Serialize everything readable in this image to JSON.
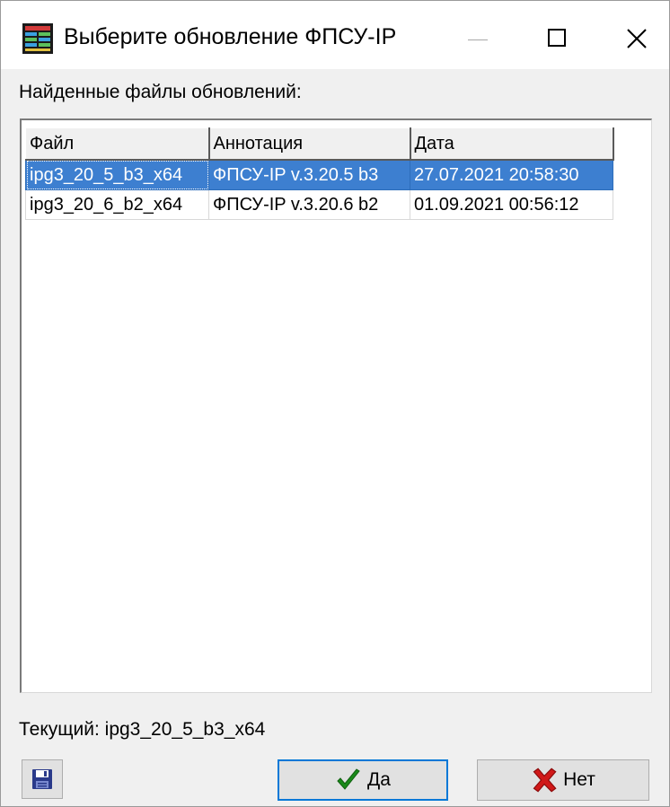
{
  "window": {
    "title": "Выберите обновление ФПСУ-IP",
    "icon": "grid-app-icon",
    "controls": {
      "minimize": "minimize-icon",
      "maximize": "maximize-icon",
      "close": "close-icon"
    }
  },
  "found_label": "Найденные файлы обновлений:",
  "table": {
    "columns": [
      "Файл",
      "Аннотация",
      "Дата"
    ],
    "rows": [
      {
        "file": "ipg3_20_5_b3_x64",
        "annotation": "ФПСУ-IP v.3.20.5 b3",
        "date": "27.07.2021 20:58:30",
        "selected": true
      },
      {
        "file": "ipg3_20_6_b2_x64",
        "annotation": "ФПСУ-IP v.3.20.6 b2",
        "date": "01.09.2021 00:56:12",
        "selected": false
      }
    ]
  },
  "current": "Текущий: ipg3_20_5_b3_x64",
  "buttons": {
    "save_icon": "floppy-disk-icon",
    "yes_label": "Да",
    "yes_icon": "checkmark-icon",
    "no_label": "Нет",
    "no_icon": "cross-icon"
  },
  "colors": {
    "selection": "#3d7fd0",
    "focus_border": "#0078d7",
    "check_green": "#1a8a1a",
    "cross_red": "#d01818"
  }
}
